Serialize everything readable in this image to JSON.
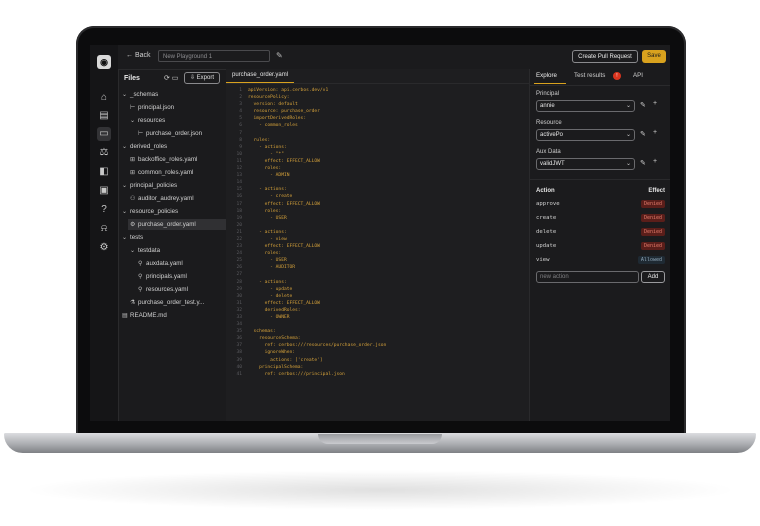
{
  "topbar": {
    "back_label": "← Back",
    "playground_name": "New Playground 1",
    "pull_request_label": "Create Pull Request",
    "save_label": "Save"
  },
  "files": {
    "title": "Files",
    "export_label": "Export",
    "items": [
      {
        "label": "_schemas",
        "kind": "folder-open"
      },
      {
        "label": "principal.json",
        "kind": "file-json"
      },
      {
        "label": "resources",
        "kind": "folder-open"
      },
      {
        "label": "purchase_order.json",
        "kind": "file-json"
      },
      {
        "label": "derived_roles",
        "kind": "folder-open"
      },
      {
        "label": "backoffice_roles.yaml",
        "kind": "file-roles"
      },
      {
        "label": "common_roles.yaml",
        "kind": "file-roles"
      },
      {
        "label": "principal_policies",
        "kind": "folder-open"
      },
      {
        "label": "auditor_audrey.yaml",
        "kind": "file-principal"
      },
      {
        "label": "resource_policies",
        "kind": "folder-open"
      },
      {
        "label": "purchase_order.yaml",
        "kind": "file-resource"
      },
      {
        "label": "tests",
        "kind": "folder-open"
      },
      {
        "label": "testdata",
        "kind": "folder-open"
      },
      {
        "label": "auxdata.yaml",
        "kind": "file-data"
      },
      {
        "label": "principals.yaml",
        "kind": "file-data"
      },
      {
        "label": "resources.yaml",
        "kind": "file-data"
      },
      {
        "label": "purchase_order_test.y...",
        "kind": "file-test"
      },
      {
        "label": "README.md",
        "kind": "file-md"
      }
    ]
  },
  "editor": {
    "tab_label": "purchase_order.yaml",
    "lines": [
      "apiVersion: api.cerbos.dev/v1",
      "resourcePolicy:",
      "  version: default",
      "  resource: purchase_order",
      "  importDerivedRoles:",
      "    - common_roles",
      "",
      "  rules:",
      "    - actions:",
      "        - \"*\"",
      "      effect: EFFECT_ALLOW",
      "      roles:",
      "        - ADMIN",
      "",
      "    - actions:",
      "        - create",
      "      effect: EFFECT_ALLOW",
      "      roles:",
      "        - USER",
      "",
      "    - actions:",
      "        - view",
      "      effect: EFFECT_ALLOW",
      "      roles:",
      "        - USER",
      "        - AUDITOR",
      "",
      "    - actions:",
      "        - update",
      "        - delete",
      "      effect: EFFECT_ALLOW",
      "      derivedRoles:",
      "        - OWNER",
      "",
      "  schemas:",
      "    resourceSchema:",
      "      ref: cerbos:///resources/purchase_order.json",
      "      ignoreWhen:",
      "        actions: ['create']",
      "    principalSchema:",
      "      ref: cerbos:///principal.json"
    ]
  },
  "panel": {
    "tabs": [
      "Explore",
      "Test results",
      "API"
    ],
    "test_results_badge": "!",
    "principal_label": "Principal",
    "principal_value": "annie",
    "resource_label": "Resource",
    "resource_value": "activePo",
    "aux_label": "Aux Data",
    "aux_value": "validJWT",
    "action_header": "Action",
    "effect_header": "Effect",
    "actions": [
      {
        "name": "approve",
        "effect": "Denied"
      },
      {
        "name": "create",
        "effect": "Denied"
      },
      {
        "name": "delete",
        "effect": "Denied"
      },
      {
        "name": "update",
        "effect": "Denied"
      },
      {
        "name": "view",
        "effect": "Allowed"
      }
    ],
    "new_action_placeholder": "new action",
    "add_label": "Add"
  }
}
